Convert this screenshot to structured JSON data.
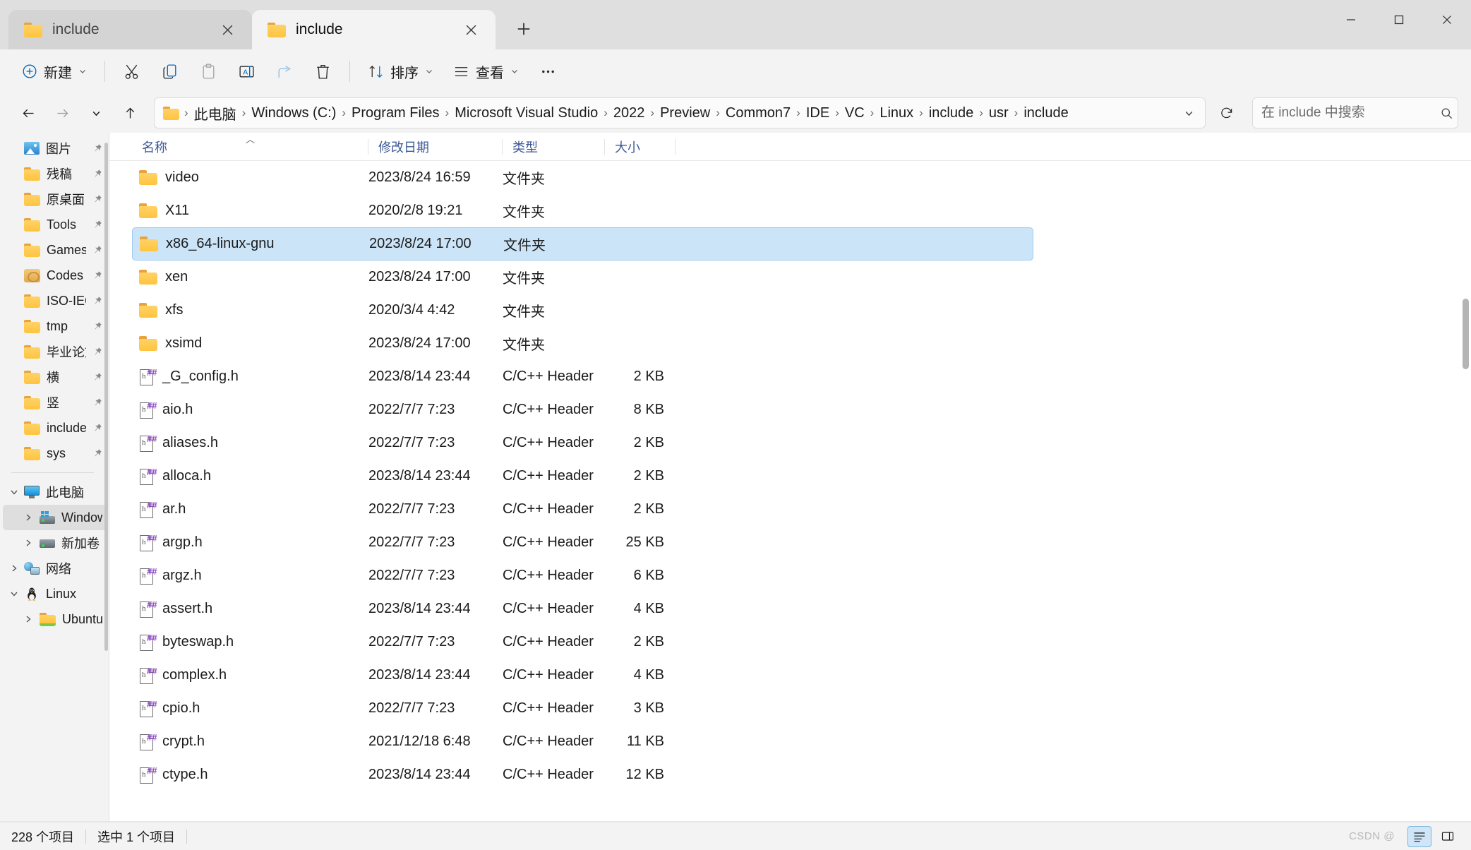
{
  "window": {
    "tabs": [
      {
        "label": "include",
        "active": false,
        "icon": "folder-icon"
      },
      {
        "label": "include",
        "active": true,
        "icon": "folder-icon"
      }
    ],
    "new_tab_label": "+",
    "controls": {
      "minimize": "minimize-icon",
      "maximize": "maximize-icon",
      "close": "close-icon"
    }
  },
  "toolbar": {
    "new_label": "新建",
    "cut_label": "剪切",
    "copy_label": "复制",
    "paste_label": "粘贴",
    "rename_label": "重命名",
    "share_label": "共享",
    "delete_label": "删除",
    "sort_label": "排序",
    "view_label": "查看",
    "more_label": "…"
  },
  "address": {
    "back_label": "后退",
    "forward_label": "前进",
    "recent_label": "最近浏览",
    "up_label": "向上",
    "crumbs": [
      "此电脑",
      "Windows (C:)",
      "Program Files",
      "Microsoft Visual Studio",
      "2022",
      "Preview",
      "Common7",
      "IDE",
      "VC",
      "Linux",
      "include",
      "usr",
      "include"
    ],
    "separator": "›",
    "refresh_label": "刷新"
  },
  "search": {
    "placeholder": "在 include 中搜索",
    "value": ""
  },
  "sidebar": {
    "quick_items": [
      {
        "label": "图片",
        "icon": "picture-icon",
        "pinned": true
      },
      {
        "label": "残稿",
        "icon": "folder-icon",
        "pinned": true
      },
      {
        "label": "原桌面",
        "icon": "folder-icon",
        "pinned": true
      },
      {
        "label": "Tools",
        "icon": "folder-icon",
        "pinned": true
      },
      {
        "label": "Games",
        "icon": "folder-icon",
        "pinned": true
      },
      {
        "label": "Codes",
        "icon": "codes-folder-icon",
        "pinned": true
      },
      {
        "label": "ISO-IEC",
        "icon": "folder-icon",
        "pinned": true
      },
      {
        "label": "tmp",
        "icon": "folder-icon",
        "pinned": true
      },
      {
        "label": "毕业论文",
        "icon": "folder-icon",
        "pinned": true
      },
      {
        "label": "横",
        "icon": "folder-icon",
        "pinned": true
      },
      {
        "label": "竖",
        "icon": "folder-icon",
        "pinned": true
      },
      {
        "label": "include",
        "icon": "folder-icon",
        "pinned": true
      },
      {
        "label": "sys",
        "icon": "folder-icon",
        "pinned": true
      }
    ],
    "tree_items": [
      {
        "label": "此电脑",
        "icon": "this-pc-icon",
        "expanded": true,
        "level": 1,
        "selected": false
      },
      {
        "label": "Windows (C:)",
        "icon": "windows-drive-icon",
        "expanded": false,
        "level": 2,
        "selected": true
      },
      {
        "label": "新加卷 (D:)",
        "icon": "drive-icon",
        "expanded": false,
        "level": 2,
        "selected": false
      },
      {
        "label": "网络",
        "icon": "network-icon",
        "expanded": false,
        "level": 1,
        "selected": false
      },
      {
        "label": "Linux",
        "icon": "linux-penguin-icon",
        "expanded": true,
        "level": 1,
        "selected": false
      },
      {
        "label": "Ubuntu",
        "icon": "folder-icon",
        "expanded": false,
        "level": 2,
        "selected": false
      }
    ]
  },
  "columns": [
    {
      "key": "name",
      "label": "名称",
      "sorted": true,
      "sort_dir": "asc"
    },
    {
      "key": "date",
      "label": "修改日期",
      "sorted": false
    },
    {
      "key": "type",
      "label": "类型",
      "sorted": false
    },
    {
      "key": "size",
      "label": "大小",
      "sorted": false
    }
  ],
  "files": [
    {
      "name": "video",
      "date": "2023/8/24 16:59",
      "type": "文件夹",
      "size": "",
      "icon": "folder-icon",
      "selected": false
    },
    {
      "name": "X11",
      "date": "2020/2/8 19:21",
      "type": "文件夹",
      "size": "",
      "icon": "folder-icon",
      "selected": false
    },
    {
      "name": "x86_64-linux-gnu",
      "date": "2023/8/24 17:00",
      "type": "文件夹",
      "size": "",
      "icon": "folder-icon",
      "selected": true
    },
    {
      "name": "xen",
      "date": "2023/8/24 17:00",
      "type": "文件夹",
      "size": "",
      "icon": "folder-icon",
      "selected": false
    },
    {
      "name": "xfs",
      "date": "2020/3/4 4:42",
      "type": "文件夹",
      "size": "",
      "icon": "folder-icon",
      "selected": false
    },
    {
      "name": "xsimd",
      "date": "2023/8/24 17:00",
      "type": "文件夹",
      "size": "",
      "icon": "folder-icon",
      "selected": false
    },
    {
      "name": "_G_config.h",
      "date": "2023/8/14 23:44",
      "type": "C/C++ Header",
      "size": "2 KB",
      "icon": "header-file-icon",
      "selected": false
    },
    {
      "name": "aio.h",
      "date": "2022/7/7 7:23",
      "type": "C/C++ Header",
      "size": "8 KB",
      "icon": "header-file-icon",
      "selected": false
    },
    {
      "name": "aliases.h",
      "date": "2022/7/7 7:23",
      "type": "C/C++ Header",
      "size": "2 KB",
      "icon": "header-file-icon",
      "selected": false
    },
    {
      "name": "alloca.h",
      "date": "2023/8/14 23:44",
      "type": "C/C++ Header",
      "size": "2 KB",
      "icon": "header-file-icon",
      "selected": false
    },
    {
      "name": "ar.h",
      "date": "2022/7/7 7:23",
      "type": "C/C++ Header",
      "size": "2 KB",
      "icon": "header-file-icon",
      "selected": false
    },
    {
      "name": "argp.h",
      "date": "2022/7/7 7:23",
      "type": "C/C++ Header",
      "size": "25 KB",
      "icon": "header-file-icon",
      "selected": false
    },
    {
      "name": "argz.h",
      "date": "2022/7/7 7:23",
      "type": "C/C++ Header",
      "size": "6 KB",
      "icon": "header-file-icon",
      "selected": false
    },
    {
      "name": "assert.h",
      "date": "2023/8/14 23:44",
      "type": "C/C++ Header",
      "size": "4 KB",
      "icon": "header-file-icon",
      "selected": false
    },
    {
      "name": "byteswap.h",
      "date": "2022/7/7 7:23",
      "type": "C/C++ Header",
      "size": "2 KB",
      "icon": "header-file-icon",
      "selected": false
    },
    {
      "name": "complex.h",
      "date": "2023/8/14 23:44",
      "type": "C/C++ Header",
      "size": "4 KB",
      "icon": "header-file-icon",
      "selected": false
    },
    {
      "name": "cpio.h",
      "date": "2022/7/7 7:23",
      "type": "C/C++ Header",
      "size": "3 KB",
      "icon": "header-file-icon",
      "selected": false
    },
    {
      "name": "crypt.h",
      "date": "2021/12/18 6:48",
      "type": "C/C++ Header",
      "size": "11 KB",
      "icon": "header-file-icon",
      "selected": false
    },
    {
      "name": "ctype.h",
      "date": "2023/8/14 23:44",
      "type": "C/C++ Header",
      "size": "12 KB",
      "icon": "header-file-icon",
      "selected": false
    }
  ],
  "status": {
    "item_count": "228 个项目",
    "selection": "选中 1 个项目",
    "watermark": "CSDN @",
    "details_view_label": "详细信息",
    "preview_pane_label": "预览窗格"
  },
  "colors": {
    "selection_fill": "#cce4f7",
    "selection_border": "#9ccbee",
    "folder_yellow": "#ffc43e",
    "column_header_text": "#3b5998",
    "accent": "#0067c0"
  }
}
